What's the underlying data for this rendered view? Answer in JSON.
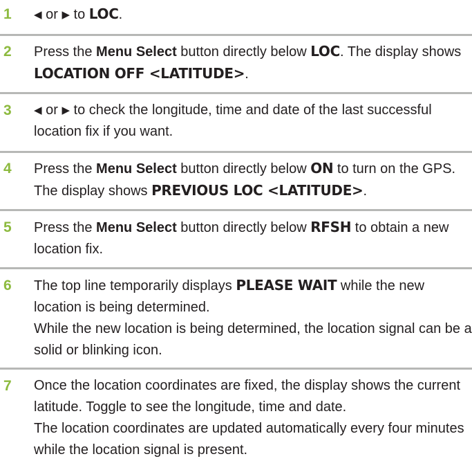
{
  "steps": [
    {
      "number": "1",
      "text": [
        {
          "t": "arrow",
          "v": "◀"
        },
        {
          "t": "plain",
          "v": " or "
        },
        {
          "t": "arrow",
          "v": "▶"
        },
        {
          "t": "plain",
          "v": " to "
        },
        {
          "t": "lcd",
          "v": "LOC"
        },
        {
          "t": "plain",
          "v": "."
        }
      ]
    },
    {
      "number": "2",
      "text": [
        {
          "t": "plain",
          "v": "Press the "
        },
        {
          "t": "bold",
          "v": "Menu Select"
        },
        {
          "t": "plain",
          "v": " button directly below "
        },
        {
          "t": "lcd",
          "v": "LOC"
        },
        {
          "t": "plain",
          "v": ". The display shows "
        },
        {
          "t": "lcd",
          "v": "LOCATION OFF <LATITUDE>"
        },
        {
          "t": "plain",
          "v": "."
        }
      ]
    },
    {
      "number": "3",
      "text": [
        {
          "t": "arrow",
          "v": "◀"
        },
        {
          "t": "plain",
          "v": " or "
        },
        {
          "t": "arrow",
          "v": "▶"
        },
        {
          "t": "plain",
          "v": " to check the longitude, time and date of the last successful location fix if you want."
        }
      ]
    },
    {
      "number": "4",
      "text": [
        {
          "t": "plain",
          "v": "Press the "
        },
        {
          "t": "bold",
          "v": "Menu Select"
        },
        {
          "t": "plain",
          "v": " button directly below "
        },
        {
          "t": "lcd",
          "v": "ON"
        },
        {
          "t": "plain",
          "v": " to turn on the GPS. The display shows "
        },
        {
          "t": "lcd",
          "v": "PREVIOUS LOC <LATITUDE>"
        },
        {
          "t": "plain",
          "v": "."
        }
      ]
    },
    {
      "number": "5",
      "text": [
        {
          "t": "plain",
          "v": "Press the "
        },
        {
          "t": "bold",
          "v": "Menu Select"
        },
        {
          "t": "plain",
          "v": " button directly below "
        },
        {
          "t": "lcd",
          "v": "RFSH"
        },
        {
          "t": "plain",
          "v": " to obtain a new location fix."
        }
      ]
    },
    {
      "number": "6",
      "text": [
        {
          "t": "plain",
          "v": "The top line temporarily displays "
        },
        {
          "t": "lcd",
          "v": "PLEASE WAIT"
        },
        {
          "t": "plain",
          "v": " while the new location is being determined."
        }
      ],
      "note": "While the new location is being determined, the location signal can be a solid or blinking icon."
    },
    {
      "number": "7",
      "text": [
        {
          "t": "plain",
          "v": "Once the location coordinates are fixed, the display shows the current latitude. Toggle to see the longitude, time and date."
        }
      ],
      "note": "The location coordinates are updated automatically every four minutes while the location signal is present."
    }
  ]
}
